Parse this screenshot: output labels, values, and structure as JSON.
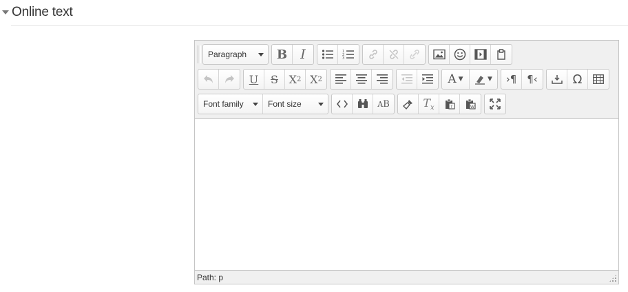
{
  "section": {
    "title": "Online text"
  },
  "editor": {
    "format_select": "Paragraph",
    "font_family_select": "Font family",
    "font_size_select": "Font size",
    "toolbar_icons": [
      "bold-icon",
      "italic-icon",
      "bullet-list-icon",
      "numbered-list-icon",
      "link-icon",
      "unlink-icon",
      "anchor-icon",
      "image-icon",
      "emoticon-icon",
      "media-icon",
      "manage-files-icon",
      "undo-icon",
      "redo-icon",
      "underline-icon",
      "strikethrough-icon",
      "subscript-icon",
      "superscript-icon",
      "align-left-icon",
      "align-center-icon",
      "align-right-icon",
      "outdent-icon",
      "indent-icon",
      "text-color-icon",
      "background-color-icon",
      "ltr-icon",
      "rtl-icon",
      "page-break-icon",
      "special-character-icon",
      "table-icon",
      "source-code-icon",
      "search-replace-icon",
      "spellcheck-icon",
      "cleanup-icon",
      "remove-format-icon",
      "paste-text-icon",
      "paste-word-icon",
      "fullscreen-icon"
    ],
    "content": "",
    "status_path": "Path: p"
  }
}
